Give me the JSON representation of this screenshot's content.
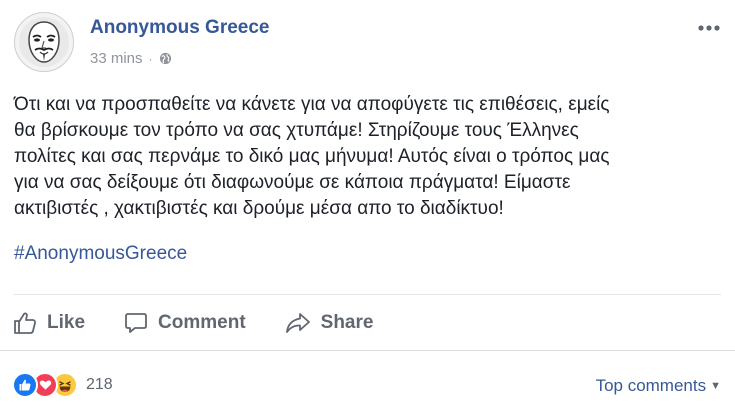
{
  "post": {
    "author": "Anonymous Greece",
    "time": "33 mins",
    "separator": "·",
    "body": "Ότι και να προσπαθείτε να κάνετε για να αποφύγετε τις επιθέσεις, εμείς\nθα βρίσκουμε τον τρόπο να σας χτυπάμε! Στηρίζουμε τους Έλληνες\nπολίτες και σας περνάμε το δικό μας μήνυμα! Αυτός είναι ο τρόπος μας\nγια να σας δείξουμε ότι διαφωνούμε σε κάποια πράγματα! Είμαστε\nακτιβιστές , χακτιβιστές και δρούμε μέσα απο το διαδίκτυο!",
    "hashtag": "#AnonymousGreece",
    "privacy_icon": "globe-icon",
    "options_icon": "more-options-icon"
  },
  "actions": {
    "like": "Like",
    "comment": "Comment",
    "share": "Share"
  },
  "reactions": {
    "types": [
      "like",
      "love",
      "haha"
    ],
    "count": "218"
  },
  "comments": {
    "sort_label": "Top comments"
  },
  "colors": {
    "link": "#365899",
    "like": "#1877f2",
    "love": "#f33e58",
    "haha": "#fcc93e"
  }
}
